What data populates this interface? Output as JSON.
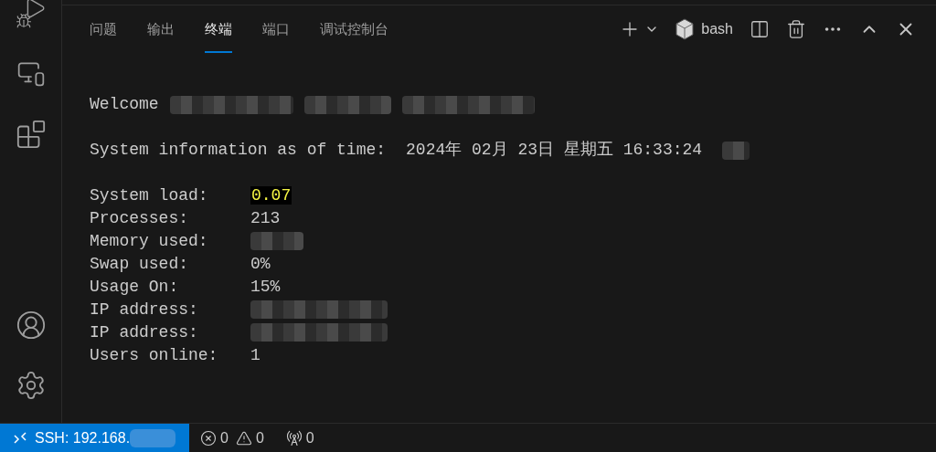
{
  "panel_tabs": [
    {
      "label": "问题",
      "selected": false
    },
    {
      "label": "输出",
      "selected": false
    },
    {
      "label": "终端",
      "selected": true
    },
    {
      "label": "端口",
      "selected": false
    },
    {
      "label": "调试控制台",
      "selected": false
    }
  ],
  "terminal_toolbar": {
    "shell": "bash"
  },
  "terminal": {
    "welcome": "Welcome",
    "info_label": "System information as of time:",
    "info_time": "2024年 02月 23日 星期五 16:33:24",
    "stats": [
      {
        "label": "System load:",
        "kind": "highlight",
        "value": "0.07"
      },
      {
        "label": "Processes:",
        "kind": "plain",
        "value": "213"
      },
      {
        "label": "Memory used:",
        "kind": "redacted"
      },
      {
        "label": "Swap used:",
        "kind": "plain",
        "value": "0%"
      },
      {
        "label": "Usage On:",
        "kind": "plain",
        "value": "15%"
      },
      {
        "label": "IP address:",
        "kind": "redacted"
      },
      {
        "label": "IP address:",
        "kind": "redacted"
      },
      {
        "label": "Users online:",
        "kind": "plain",
        "value": "1"
      }
    ]
  },
  "status_bar": {
    "remote": "SSH: 192.168.",
    "errors": "0",
    "warnings": "0",
    "ports": "0"
  }
}
